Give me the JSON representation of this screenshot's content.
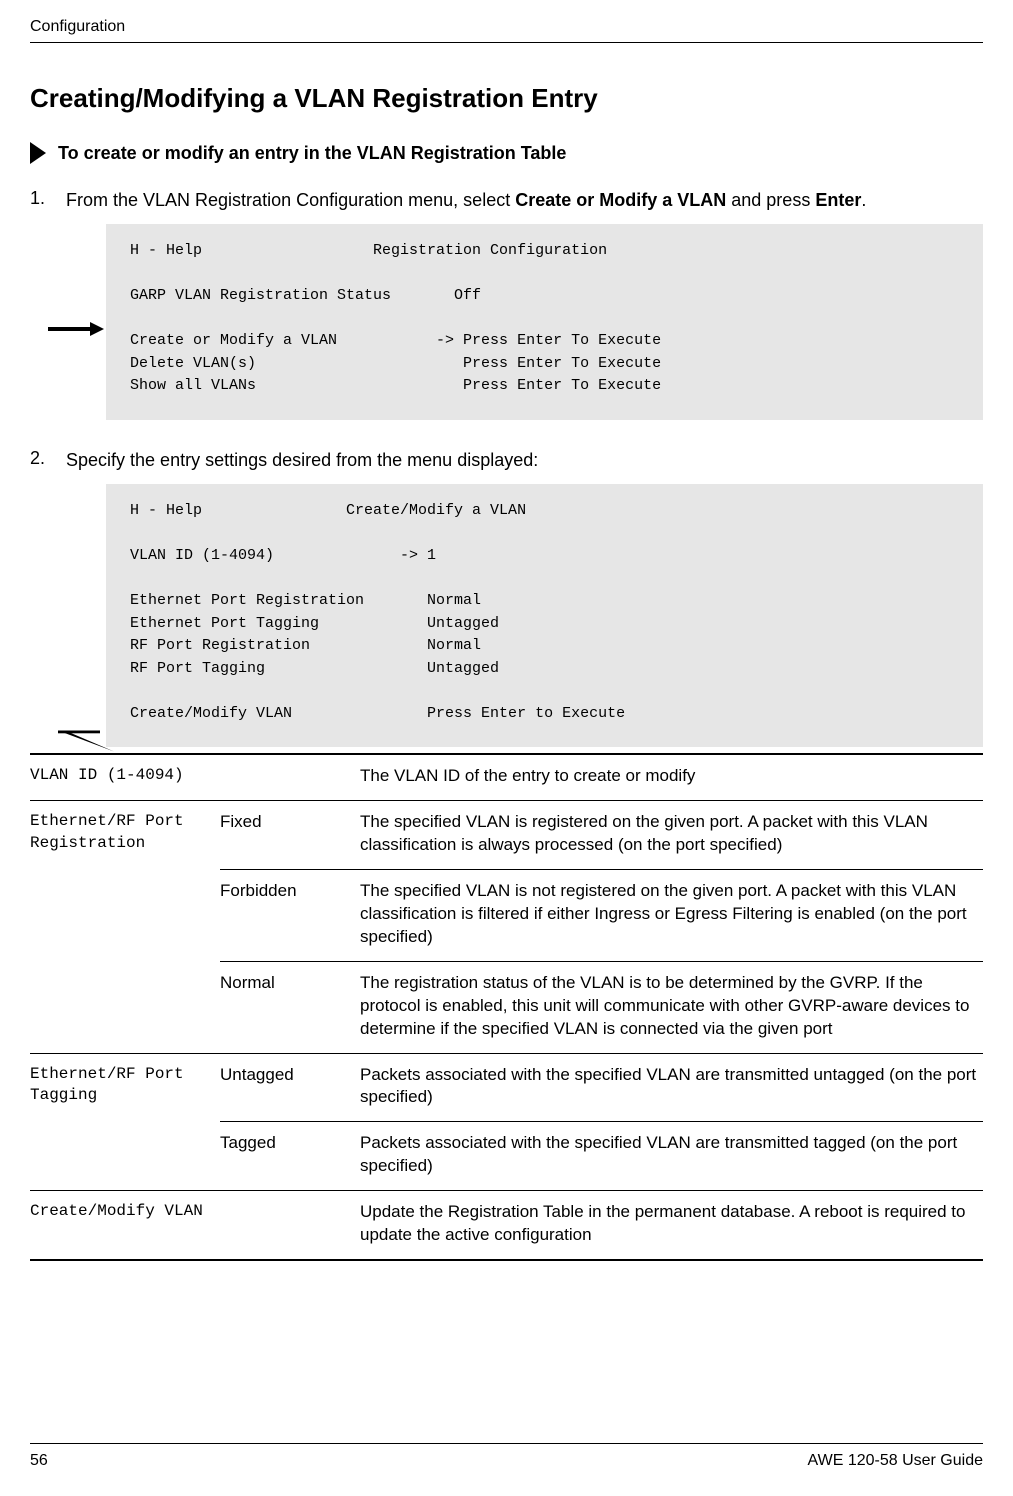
{
  "header": {
    "section": "Configuration"
  },
  "title": "Creating/Modifying a VLAN Registration Entry",
  "procedure_heading": "To create or modify an entry in the VLAN Registration Table",
  "steps": {
    "s1_num": "1.",
    "s1_pre": "From the VLAN Registration Configuration menu, select ",
    "s1_b1": "Create or Modify a VLAN",
    "s1_mid": "  and press ",
    "s1_b2": "Enter",
    "s1_post": ".",
    "s2_num": "2.",
    "s2_text": "Specify the entry settings desired from the menu displayed:"
  },
  "code1": "H - Help                   Registration Configuration\n\nGARP VLAN Registration Status       Off\n\nCreate or Modify a VLAN           -> Press Enter To Execute\nDelete VLAN(s)                       Press Enter To Execute\nShow all VLANs                       Press Enter To Execute",
  "code2": "H - Help                Create/Modify a VLAN\n\nVLAN ID (1-4094)              -> 1\n\nEthernet Port Registration       Normal\nEthernet Port Tagging            Untagged\nRF Port Registration             Normal\nRF Port Tagging                  Untagged\n\nCreate/Modify VLAN               Press Enter to Execute",
  "table": {
    "r1_param": "VLAN ID (1-4094)",
    "r1_desc": "The VLAN ID of the entry to create or modify",
    "r2_param": "Ethernet/RF Port Registration",
    "r2_opt": "Fixed",
    "r2_desc": "The specified VLAN is registered on the given port. A packet with this VLAN classification is always processed (on the port specified)",
    "r3_opt": "Forbidden",
    "r3_desc": "The specified VLAN is not registered on the given port.   A packet with this VLAN classification is filtered if either Ingress or Egress Filtering is enabled (on the port specified)",
    "r4_opt": "Normal",
    "r4_desc": "The registration status of the VLAN is to be determined by the GVRP. If the protocol is enabled, this unit will communicate with other GVRP-aware devices to determine if the specified VLAN is connected via the given port",
    "r5_param": "Ethernet/RF Port Tagging",
    "r5_opt": "Untagged",
    "r5_desc": "Packets associated with the specified VLAN are transmitted untagged (on the port specified)",
    "r6_opt": "Tagged",
    "r6_desc": "Packets associated with the specified VLAN are transmitted tagged (on the port specified)",
    "r7_param": "Create/Modify VLAN",
    "r7_desc": "Update the Registration Table in the permanent database.   A reboot is required to update the active configuration"
  },
  "footer": {
    "page": "56",
    "guide": "AWE 120-58 User Guide"
  }
}
